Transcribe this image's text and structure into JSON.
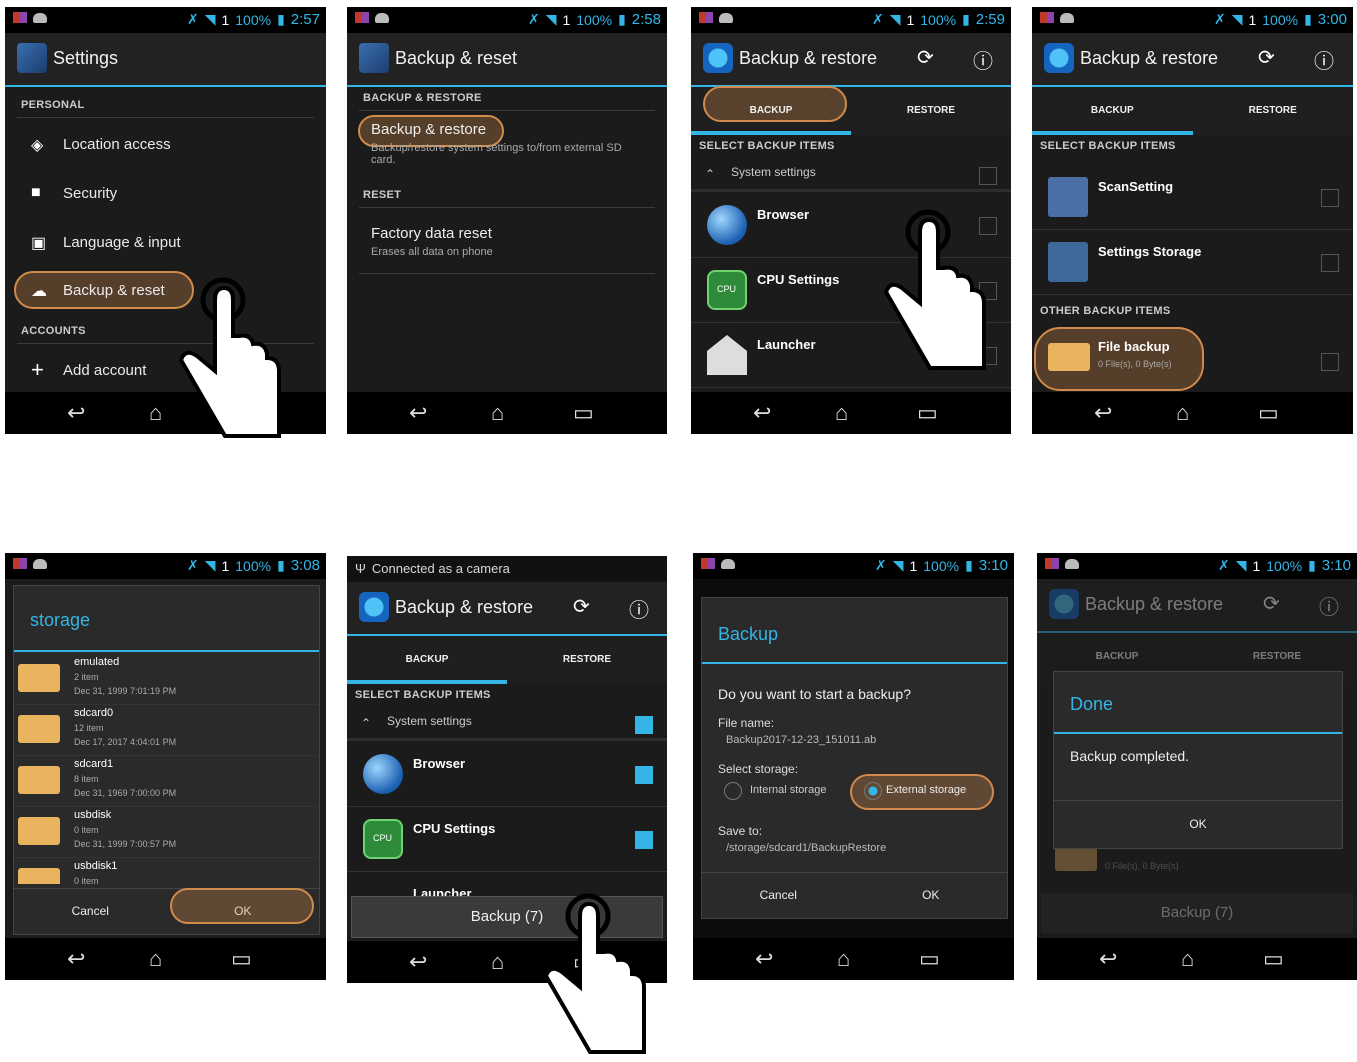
{
  "status": {
    "battery": "100%",
    "signal": "1",
    "times": [
      "2:57",
      "2:58",
      "2:59",
      "3:00",
      "3:08",
      "",
      "3:10",
      "3:10"
    ],
    "notification": "Connected as a camera"
  },
  "settings": {
    "title": "Settings",
    "personal": "PERSONAL",
    "items": [
      "Location access",
      "Security",
      "Language & input",
      "Backup & reset"
    ],
    "accounts": "ACCOUNTS",
    "add_account": "Add account"
  },
  "backup_reset": {
    "title": "Backup & reset",
    "section1": "BACKUP & RESTORE",
    "item1": "Backup & restore",
    "item1_sub": "Backup/restore system settings to/from external SD card.",
    "section2": "RESET",
    "item2": "Factory data reset",
    "item2_sub": "Erases all data on phone"
  },
  "app": {
    "title": "Backup & restore",
    "tab_backup": "BACKUP",
    "tab_restore": "RESTORE",
    "select_items": "SELECT BACKUP ITEMS",
    "system_settings": "System settings",
    "apps": [
      "Browser",
      "CPU Settings",
      "Launcher"
    ],
    "other_items": [
      "ScanSetting",
      "Settings Storage"
    ],
    "other_section": "OTHER BACKUP ITEMS",
    "file_backup": "File backup",
    "file_backup_sub": "0 File(s), 0 Byte(s)",
    "backup_button": "Backup (7)"
  },
  "storage_dialog": {
    "title": "storage",
    "folders": [
      {
        "name": "emulated",
        "count": "2 item",
        "date": "Dec 31, 1999 7:01:19 PM"
      },
      {
        "name": "sdcard0",
        "count": "12 item",
        "date": "Dec 17, 2017 4:04:01 PM"
      },
      {
        "name": "sdcard1",
        "count": "8 item",
        "date": "Dec 31, 1969 7:00:00 PM"
      },
      {
        "name": "usbdisk",
        "count": "0 item",
        "date": "Dec 31, 1999 7:00:57 PM"
      },
      {
        "name": "usbdisk1",
        "count": "0 item",
        "date": ""
      }
    ],
    "cancel": "Cancel",
    "ok": "OK"
  },
  "backup_dialog": {
    "title": "Backup",
    "question": "Do you want to start a backup?",
    "file_label": "File name:",
    "file_value": "Backup2017-12-23_151011.ab",
    "storage_label": "Select storage:",
    "internal": "Internal storage",
    "external": "External storage",
    "save_label": "Save to:",
    "save_value": "/storage/sdcard1/BackupRestore",
    "cancel": "Cancel",
    "ok": "OK"
  },
  "done_dialog": {
    "title": "Done",
    "message": "Backup completed.",
    "ok": "OK"
  },
  "colors": {
    "accent": "#33b5e5",
    "highlight": "#d08a4a",
    "bg": "#1b1b1b"
  },
  "icons": [
    "location-icon",
    "lock-icon",
    "language-icon",
    "cloud-upload-icon",
    "plus-icon",
    "sync-icon",
    "info-icon",
    "back-icon",
    "home-icon",
    "recents-icon",
    "hand-pointer-icon",
    "folder-icon"
  ]
}
